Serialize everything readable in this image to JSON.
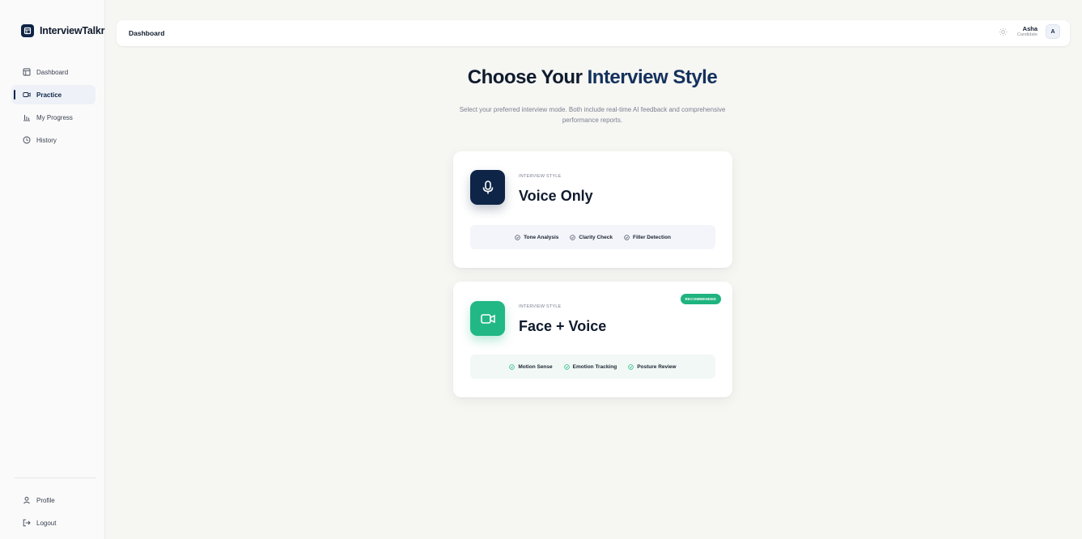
{
  "sidebar": {
    "brand": "InterviewTalkr",
    "items": [
      {
        "label": "Dashboard",
        "icon": "dashboard-icon"
      },
      {
        "label": "Practice",
        "icon": "video-icon"
      },
      {
        "label": "My Progress",
        "icon": "chart-icon"
      },
      {
        "label": "History",
        "icon": "clock-icon"
      }
    ],
    "bottom": [
      {
        "label": "Profile",
        "icon": "user-icon"
      },
      {
        "label": "Logout",
        "icon": "logout-icon"
      }
    ]
  },
  "topbar": {
    "breadcrumb": "Dashboard",
    "user_name": "Asha",
    "user_role": "Candidate",
    "avatar": "A"
  },
  "main": {
    "title_part1": "Choose Your",
    "title_accent": "Interview Style",
    "subtitle": "Select your preferred interview mode. Both include real-time AI feedback and comprehensive performance reports.",
    "cards": [
      {
        "kicker": "INTERVIEW STYLE",
        "title": "Voice Only",
        "features": [
          "Tone Analysis",
          "Clarity Check",
          "Filler Detection"
        ]
      },
      {
        "kicker": "INTERVIEW STYLE",
        "title": "Face + Voice",
        "badge": "RECOMMENDED",
        "features": [
          "Motion Sense",
          "Emotion Tracking",
          "Posture Review"
        ]
      }
    ]
  },
  "colors": {
    "navy": "#0f2547",
    "green": "#22b885",
    "background": "#f6f6f3"
  }
}
